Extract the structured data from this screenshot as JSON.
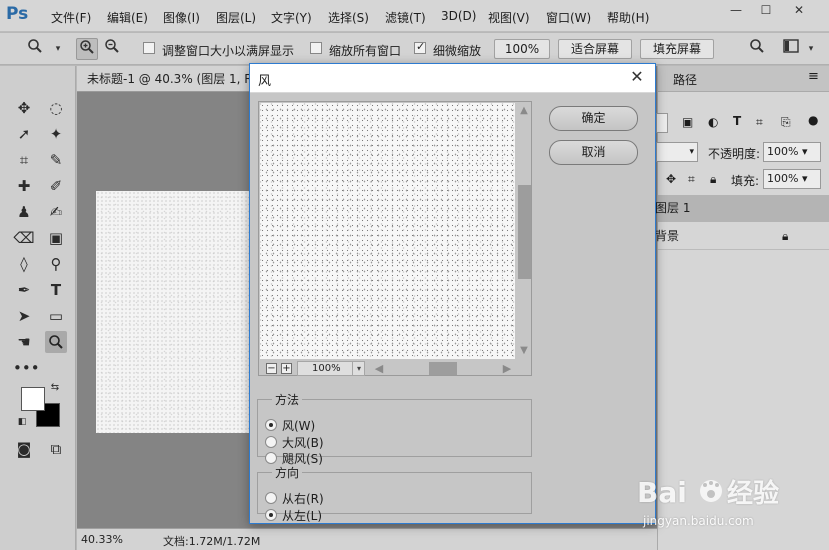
{
  "app": {
    "logo": "Ps"
  },
  "menu": [
    "文件(F)",
    "编辑(E)",
    "图像(I)",
    "图层(L)",
    "文字(Y)",
    "选择(S)",
    "滤镜(T)",
    "3D(D)",
    "视图(V)",
    "窗口(W)",
    "帮助(H)"
  ],
  "window_controls": {
    "minimize": "—",
    "maximize": "☐",
    "close": "✕"
  },
  "options_bar": {
    "resize_windows_label": "调整窗口大小以满屏显示",
    "zoom_all_label": "缩放所有窗口",
    "scrubby_zoom_label": "细微缩放",
    "zoom_value": "100%",
    "fit_screen": "适合屏幕",
    "fill_screen": "填充屏幕"
  },
  "document": {
    "tab_title": "未标题-1 @ 40.3% (图层 1, R",
    "status_zoom": "40.33%",
    "status_doc": "文档:1.72M/1.72M"
  },
  "panels": {
    "tab_paths": "路径",
    "opacity_label": "不透明度:",
    "opacity_value": "100%",
    "fill_label": "填充:",
    "fill_value": "100%",
    "layers": [
      {
        "name": "图层 1"
      },
      {
        "name": "背景"
      }
    ]
  },
  "dialog": {
    "title": "风",
    "ok": "确定",
    "cancel": "取消",
    "preview_zoom": "100%",
    "method": {
      "legend": "方法",
      "options": [
        "风(W)",
        "大风(B)",
        "飓风(S)"
      ],
      "selected": 0
    },
    "direction": {
      "legend": "方向",
      "options": [
        "从右(R)",
        "从左(L)"
      ],
      "selected": 1
    }
  },
  "watermark": {
    "logo": "Bai百经验",
    "url": "jingyan.baidu.com"
  },
  "colors": {
    "accent": "#2d7bd0",
    "ps_logo": "#2a6aa6"
  }
}
